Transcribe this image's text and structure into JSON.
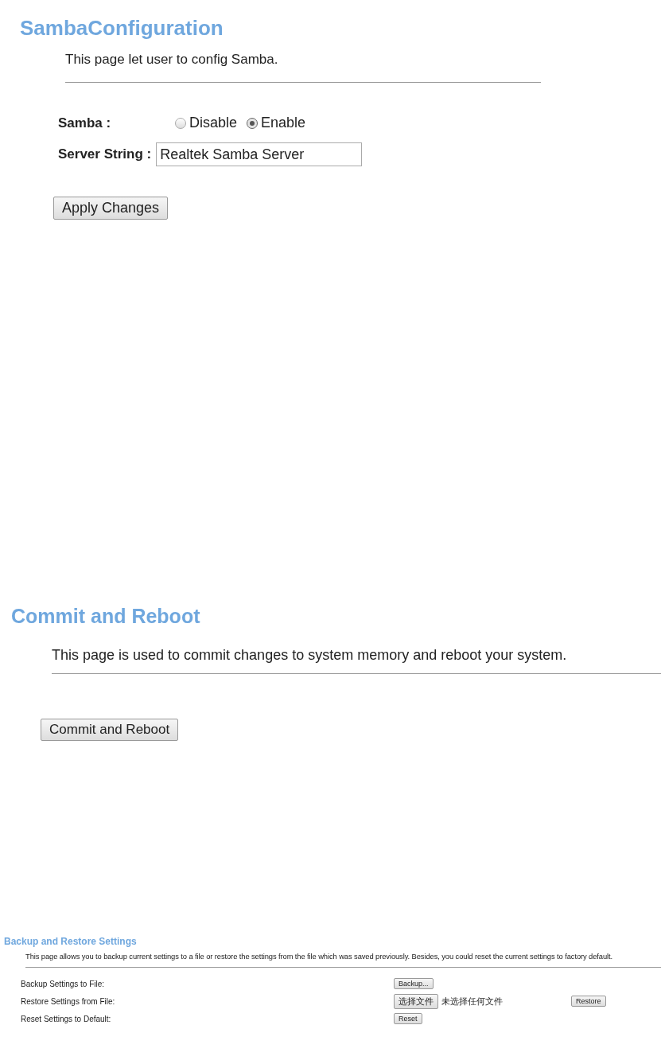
{
  "samba_configuration": {
    "title": "SambaConfiguration",
    "description": "This page let user to config Samba.",
    "samba_label": "Samba :",
    "options": [
      {
        "label": "Disable",
        "selected": false
      },
      {
        "label": "Enable",
        "selected": true
      }
    ],
    "server_string_label": "Server String :",
    "server_string_value": "Realtek Samba Server",
    "apply_button": "Apply Changes"
  },
  "commit_and_reboot": {
    "title": "Commit and Reboot",
    "description": "This page is used to commit changes to system memory and reboot your system.",
    "button": "Commit and Reboot"
  },
  "backup_and_restore": {
    "title": "Backup and Restore Settings",
    "description": "This page allows you to backup current settings to a file or restore the settings from the file which was saved previously. Besides, you could reset the current settings to factory default.",
    "rows": [
      {
        "kind": "button",
        "label": "Backup Settings to File:",
        "button": "Backup..."
      },
      {
        "kind": "file",
        "label": "Restore Settings from File:",
        "file_button": "选择文件",
        "file_status": "未选择任何文件",
        "button": "Restore"
      },
      {
        "kind": "button",
        "label": "Reset Settings to Default:",
        "button": "Reset"
      }
    ]
  }
}
